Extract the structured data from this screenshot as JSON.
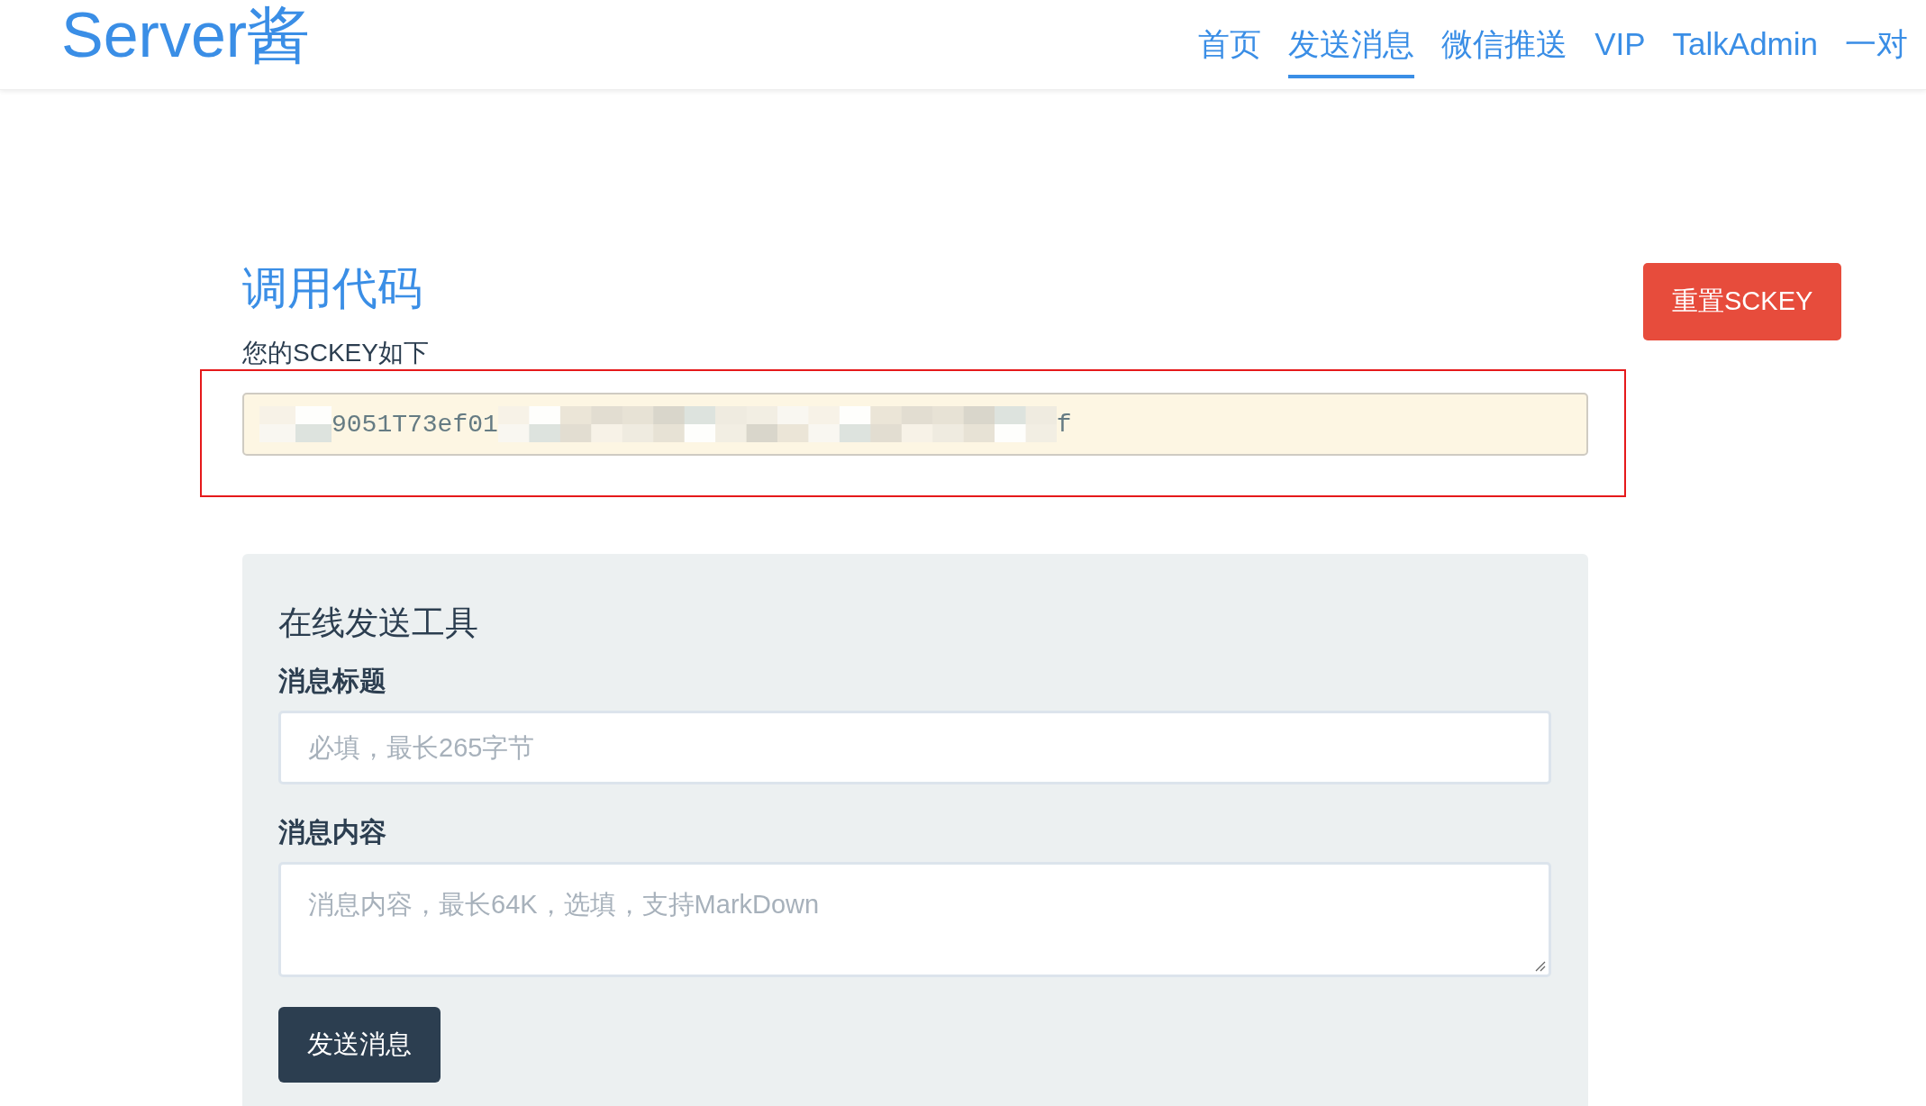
{
  "header": {
    "logo": "Server酱",
    "nav": [
      {
        "label": "首页",
        "selected": false
      },
      {
        "label": "发送消息",
        "selected": true
      },
      {
        "label": "微信推送",
        "selected": false
      },
      {
        "label": "VIP",
        "selected": false
      },
      {
        "label": "TalkAdmin",
        "selected": false
      },
      {
        "label": "一对",
        "selected": false
      }
    ]
  },
  "api_section": {
    "title": "调用代码",
    "reset_button": "重置SCKEY",
    "sckey_label": "您的SCKEY如下",
    "sckey_field": {
      "highlighted": true,
      "segments": [
        {
          "kind": "redacted"
        },
        {
          "kind": "text",
          "text": "9051T73ef01"
        },
        {
          "kind": "redacted"
        },
        {
          "kind": "text",
          "text": "f"
        }
      ]
    }
  },
  "send_tool": {
    "title": "在线发送工具",
    "fields": [
      {
        "kind": "input",
        "label": "消息标题",
        "placeholder": "必填，最长265字节"
      },
      {
        "kind": "textarea",
        "label": "消息内容",
        "placeholder": "消息内容，最长64K，选填，支持MarkDown"
      }
    ],
    "submit_button": "发送消息"
  }
}
